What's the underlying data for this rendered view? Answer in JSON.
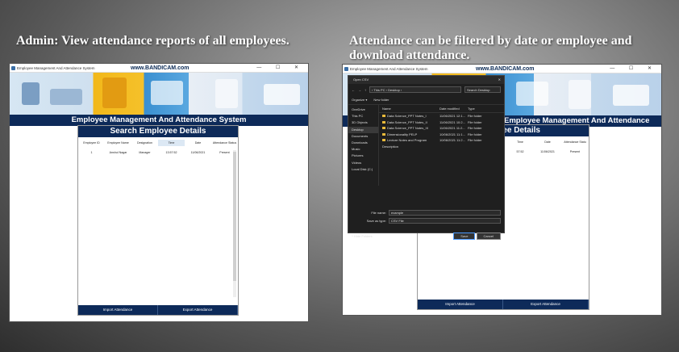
{
  "captions": {
    "left": "Admin: View attendance reports of all employees.",
    "right": "Attendance can be filtered by date or employee and download attendance."
  },
  "app": {
    "window_title": "Employee Management And Attendance System",
    "watermark": "www.BANDICAM.com",
    "heading": "Employee Management And Attendance System",
    "window_controls": "— ☐ ✕"
  },
  "left_panel": {
    "title": "Search Employee Details",
    "columns": [
      "Employee ID",
      "Employee Name",
      "Designation",
      "Time",
      "Date",
      "Attendance Status"
    ],
    "rows": [
      [
        "1",
        "Anshul Nagar",
        "Manager",
        "13:57:52",
        "11/06/2021",
        "Present"
      ]
    ],
    "buttons": [
      "Import Attendance",
      "Export Attendance"
    ]
  },
  "right_panel": {
    "title_partial": "Employee Management And Attendance System",
    "panel_title_partial": "oyee Details",
    "columns_partial": [
      "Time",
      "Date",
      "Attendance Statu"
    ],
    "row_partial": [
      "57:52",
      "11/06/2021",
      "Present"
    ],
    "buttons": [
      "Import Attendance",
      "Export Attendance"
    ]
  },
  "dialog": {
    "title": "Open CSV",
    "close": "✕",
    "path": "› This PC › Desktop ›",
    "search_placeholder": "Search Desktop",
    "toolbar": [
      "Organize ▾",
      "New folder"
    ],
    "nav": [
      "OneDrive",
      "This PC",
      "3D Objects",
      "Desktop",
      "Documents",
      "Downloads",
      "Music",
      "Pictures",
      "Videos",
      "Local Disk (C:)"
    ],
    "nav_selected": 3,
    "columns": [
      "Name",
      "Date modified",
      "Type"
    ],
    "files": [
      {
        "name": "Data Science_PPT Notes_I",
        "date": "11/06/2021 12:1...",
        "type": "File folder"
      },
      {
        "name": "Data Science_PPT Notes_II",
        "date": "11/06/2021 10:2...",
        "type": "File folder"
      },
      {
        "name": "Data Science_PPT Notes_III",
        "date": "11/06/2021 11:2...",
        "type": "File folder"
      },
      {
        "name": "Dimensionality PELP",
        "date": "10/06/2021 11:1...",
        "type": "File folder"
      },
      {
        "name": "Lecture Notes and Program Description",
        "date": "10/06/2021 11:2...",
        "type": "File folder"
      }
    ],
    "file_name_label": "File name:",
    "file_name_value": "example",
    "save_type_label": "Save as type:",
    "save_type_value": "CSV File",
    "hide_folders": "^ Hide Folders",
    "save_button": "Save",
    "cancel_button": "Cancel"
  },
  "colors": {
    "navy": "#0d2a59",
    "dialog_bg": "#1f1f1f"
  }
}
